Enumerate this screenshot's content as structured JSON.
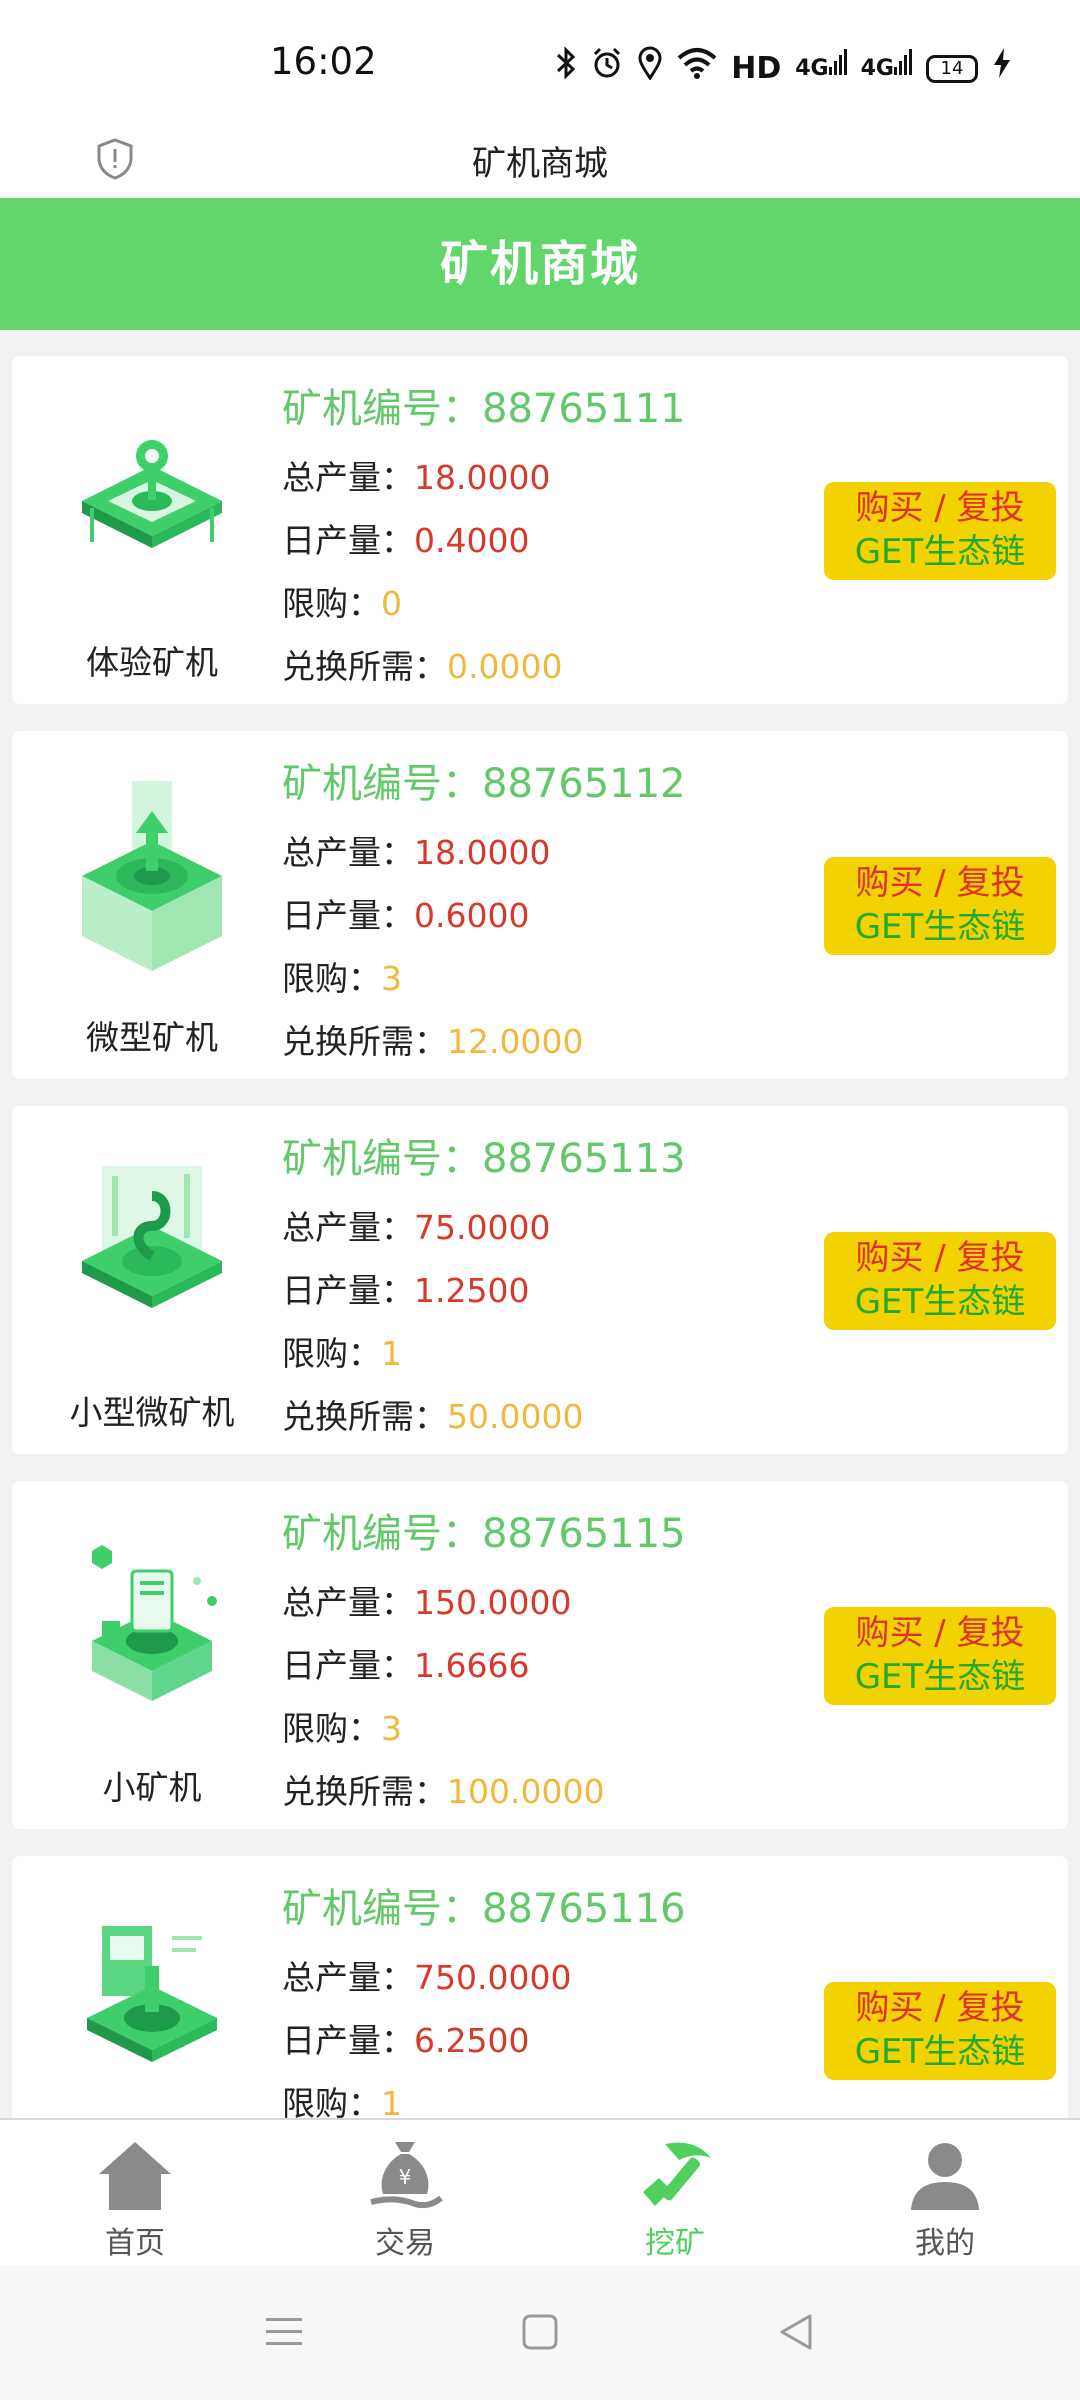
{
  "status": {
    "time": "16:02",
    "network_label": "HD",
    "signal1": "4G",
    "signal2": "4G",
    "battery": "14"
  },
  "titlebar": {
    "title": "矿机商城"
  },
  "header": {
    "title": "矿机商城"
  },
  "labels": {
    "id_prefix": "矿机编号：",
    "total": "总产量：",
    "daily": "日产量：",
    "limit": "限购：",
    "cost": "兑换所需："
  },
  "buy_button": {
    "line1": "购买 / 复投",
    "line2": "GET生态链"
  },
  "machines": [
    {
      "name": "体验矿机",
      "id": "88765111",
      "total": "18.0000",
      "daily": "0.4000",
      "limit": "0",
      "cost": "0.0000"
    },
    {
      "name": "微型矿机",
      "id": "88765112",
      "total": "18.0000",
      "daily": "0.6000",
      "limit": "3",
      "cost": "12.0000"
    },
    {
      "name": "小型微矿机",
      "id": "88765113",
      "total": "75.0000",
      "daily": "1.2500",
      "limit": "1",
      "cost": "50.0000"
    },
    {
      "name": "小矿机",
      "id": "88765115",
      "total": "150.0000",
      "daily": "1.6666",
      "limit": "3",
      "cost": "100.0000"
    },
    {
      "name": "",
      "id": "88765116",
      "total": "750.0000",
      "daily": "6.2500",
      "limit": "1",
      "cost": ""
    }
  ],
  "tabs": [
    {
      "label": "首页",
      "icon": "home-icon"
    },
    {
      "label": "交易",
      "icon": "money-bag-icon"
    },
    {
      "label": "挖矿",
      "icon": "pickaxe-icon",
      "active": true
    },
    {
      "label": "我的",
      "icon": "user-icon"
    }
  ],
  "colors": {
    "brand_green": "#62d56b",
    "button_yellow": "#f2d200",
    "value_red": "#d8392b",
    "value_yellow": "#f0b83c"
  }
}
